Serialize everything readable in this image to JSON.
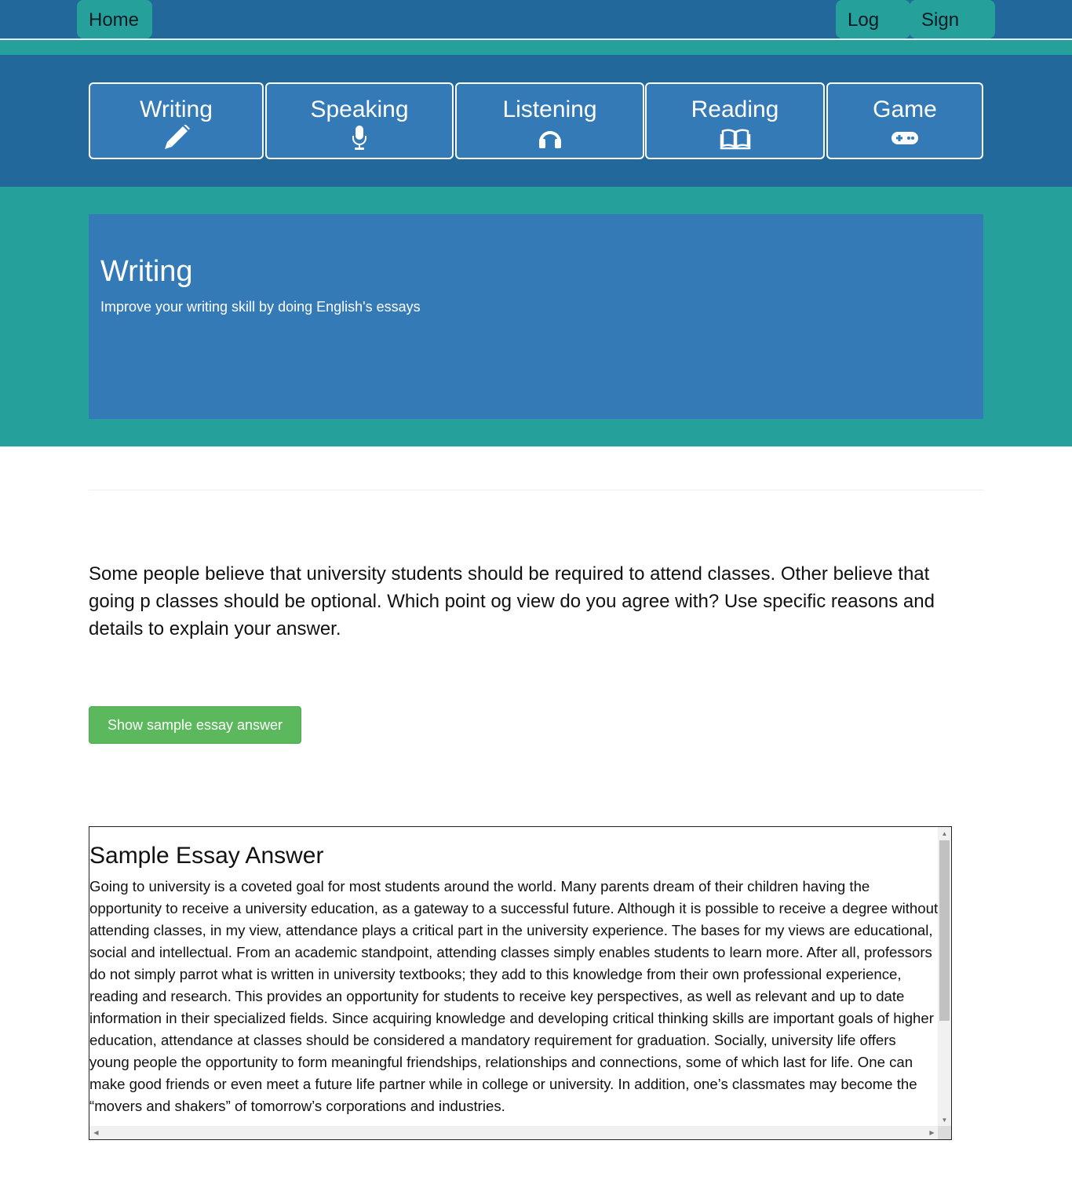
{
  "nav": {
    "home": "Home",
    "login": "Log in",
    "signup": "Sign up"
  },
  "skills": [
    {
      "label": "Writing",
      "icon": "pencil-icon"
    },
    {
      "label": "Speaking",
      "icon": "microphone-icon"
    },
    {
      "label": "Listening",
      "icon": "headphones-icon"
    },
    {
      "label": "Reading",
      "icon": "book-icon"
    },
    {
      "label": "Game",
      "icon": "gamepad-icon"
    }
  ],
  "hero": {
    "title": "Writing",
    "subtitle": "Improve your writing skill by doing English's essays"
  },
  "prompt": "Some people believe that university students should be required to attend classes. Other believe that going p classes should be optional. Which point og view do you agree with? Use specific reasons and details to explain your answer.",
  "show_button": "Show  sample essay answer",
  "essay": {
    "title": "Sample Essay Answer",
    "body": "Going to university is a coveted goal for most students around the world. Many parents dream of their children having the opportunity to receive a university education, as a gateway to a successful future. Although it is possible to receive a degree without attending classes, in my view, attendance plays a critical part in the university experience. The bases for my views are educational, social and intellectual. From an academic standpoint, attending classes simply enables students to learn more. After all, professors do not simply parrot what is written in university textbooks; they add to this knowledge from their own professional experience, reading and research. This provides an opportunity for students to receive key perspectives, as well as relevant and up to date information in their specialized fields. Since acquiring knowledge and developing critical thinking skills are important goals of higher education, attendance at classes should be considered a mandatory requirement for graduation. Socially, university life offers young people the opportunity to form meaningful friendships, relationships and connections, some of which last for life. One can make good friends or even meet a future life partner while in college or university. In addition, one’s classmates may become the “movers and shakers” of tomorrow’s corporations and industries."
  },
  "colors": {
    "navy": "#23689b",
    "teal": "#25a09a",
    "tile": "#337ab7",
    "success": "#5cb85c"
  }
}
